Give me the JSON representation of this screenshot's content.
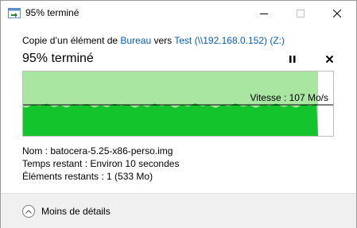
{
  "window": {
    "title": "95% terminé",
    "controls": {
      "minimize_icon": "minimize-icon",
      "maximize_icon": "maximize-icon",
      "close_icon": "close-icon"
    }
  },
  "copy": {
    "prefix": "Copie d’un élément de ",
    "source": "Bureau",
    "middle": " vers ",
    "destination": "Test (\\\\192.168.0.152) (Z:)"
  },
  "progress": {
    "title": "95% terminé",
    "percent": 95,
    "pause_icon": "pause-icon",
    "cancel_icon": "close-icon"
  },
  "graph": {
    "speed_label": "Vitesse : 107 Mo/s",
    "fill_color": "#13c42c",
    "background_fill": "#a8e6a1",
    "line_color": "#000000"
  },
  "details": {
    "name_label": "Nom : ",
    "name_value": " batocera-5.25-x86-perso.img",
    "time_label": "Temps restant : ",
    "time_value": " Environ 10 secondes",
    "items_label": "Éléments restants : ",
    "items_value": " 1 (533 Mo)"
  },
  "footer": {
    "toggle_label": "Moins de détails",
    "toggle_icon": "chevron-up-icon"
  }
}
